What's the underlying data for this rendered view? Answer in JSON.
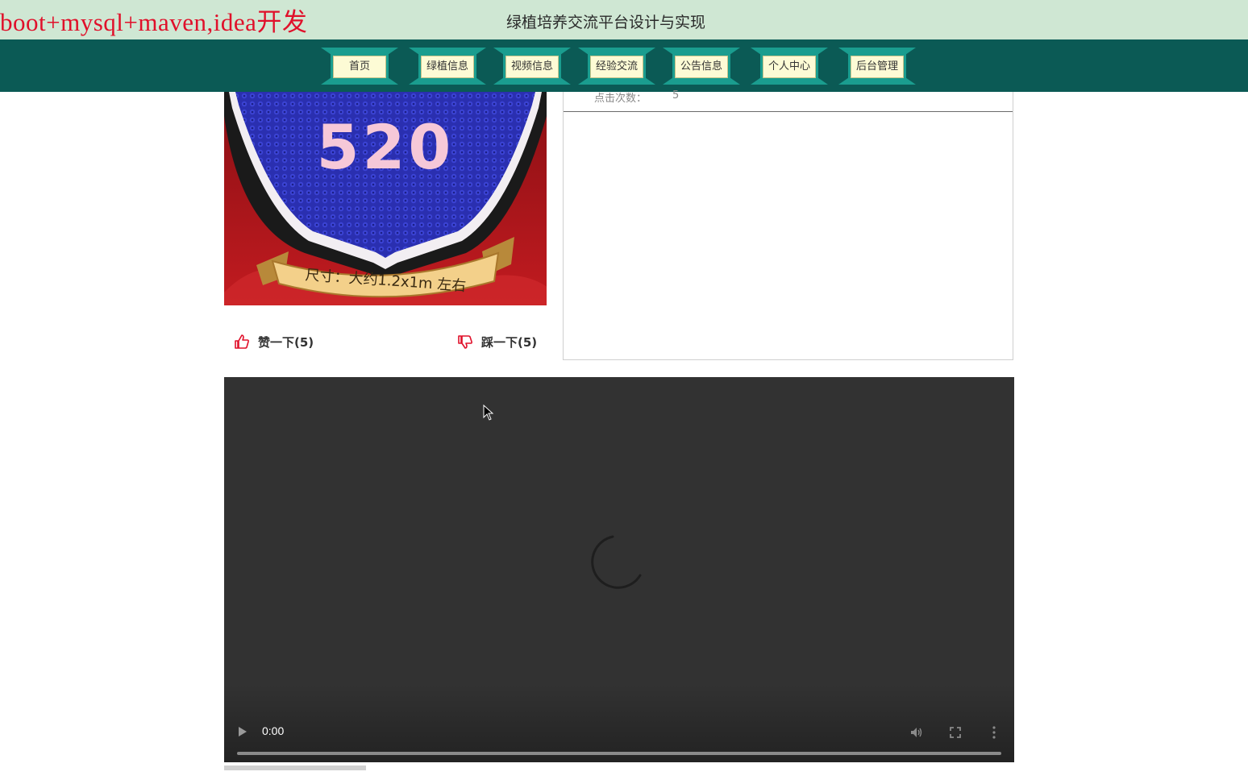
{
  "header": {
    "watermark": "boot+mysql+maven,idea开发",
    "site_title": "绿植培养交流平台设计与实现"
  },
  "nav": {
    "items": [
      {
        "label": "首页"
      },
      {
        "label": "绿植信息"
      },
      {
        "label": "视频信息"
      },
      {
        "label": "经验交流"
      },
      {
        "label": "公告信息"
      },
      {
        "label": "个人中心"
      },
      {
        "label": "后台管理"
      }
    ]
  },
  "detail": {
    "image_text": "尺寸：大约1.2x1m 左右",
    "image_number": "520",
    "info": {
      "label": "点击次数：",
      "value": "5"
    }
  },
  "votes": {
    "like": "赞一下(5)",
    "dislike": "踩一下(5)"
  },
  "video": {
    "time": "0:00"
  },
  "colors": {
    "topbar": "#cfe7d3",
    "navbar": "#0b5a55",
    "nav_tab": "#1a9d8f",
    "nav_label_bg": "#fdfbd5",
    "watermark": "#e0102a",
    "vote_icon": "#e0102a"
  }
}
